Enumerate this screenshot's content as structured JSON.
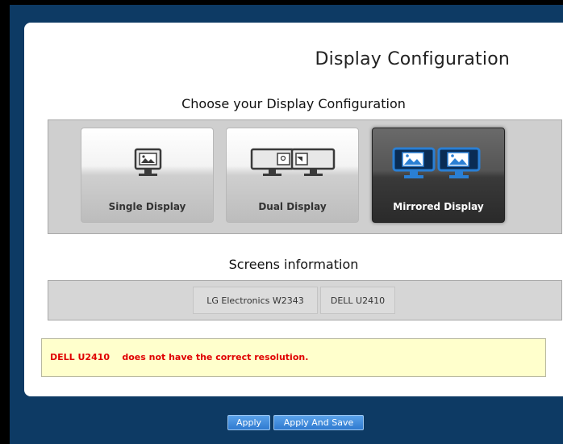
{
  "header": {
    "title": "Display Configuration"
  },
  "configuration": {
    "heading": "Choose your Display Configuration",
    "options": [
      {
        "label": "Single Display",
        "selected": false,
        "icon": "single-monitor-icon"
      },
      {
        "label": "Dual Display",
        "selected": false,
        "icon": "dual-monitor-icon"
      },
      {
        "label": "Mirrored Display",
        "selected": true,
        "icon": "mirrored-monitor-icon"
      }
    ]
  },
  "screens": {
    "heading": "Screens information",
    "items": [
      "LG Electronics W2343",
      "DELL U2410"
    ]
  },
  "alert": {
    "message": "DELL U2410    does not have the correct resolution.",
    "color": "#e00000"
  },
  "buttons": {
    "apply": "Apply",
    "apply_and_save": "Apply And Save"
  },
  "colors": {
    "background": "#0d3a64",
    "selected_accent": "#2a7fd4"
  }
}
